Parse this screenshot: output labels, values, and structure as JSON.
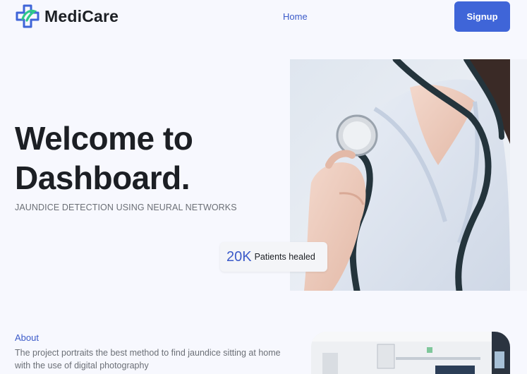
{
  "header": {
    "brand": "MediCare",
    "logo_icon": "medical-cross-logo-icon",
    "nav": {
      "home_label": "Home"
    },
    "signup_label": "Signup"
  },
  "hero": {
    "title_line1": "Welcome to",
    "title_line2": "Dashboard.",
    "subtitle": "JAUNDICE DETECTION USING NEURAL NETWORKS",
    "image": "doctor-with-stethoscope-photo",
    "stat": {
      "value": "20K",
      "label": "Patients healed"
    }
  },
  "about": {
    "heading": "About",
    "text": "The project portraits the best method to find jaundice sitting at home with the use of digital photography",
    "image": "hospital-room-photo"
  },
  "colors": {
    "accent": "#3f65d8",
    "link": "#3c5bc9",
    "logo_green": "#2fc98a",
    "background": "#f7f8fe",
    "heading": "#1c1f24",
    "muted": "#6b6f76"
  }
}
